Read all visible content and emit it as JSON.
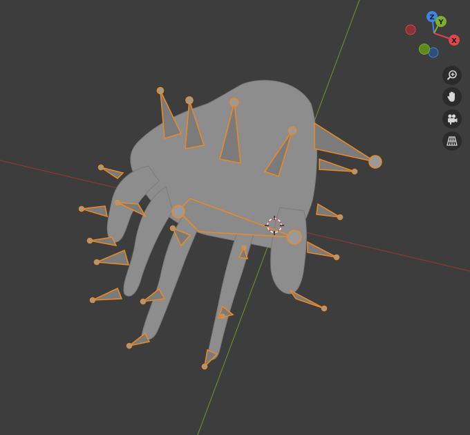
{
  "viewport": {
    "background": "#3d3d3d",
    "x_axis_color": "#8a3a3a",
    "y_axis_color": "#6a8a2a",
    "mesh_color": "#8d8d8d",
    "bone_outline": "#e98a26",
    "bone_fill": "#7b7b7b"
  },
  "gizmo": {
    "x_label": "X",
    "y_label": "Y",
    "z_label": "Z",
    "x_color": "#e0464c",
    "y_color": "#7fb02a",
    "z_color": "#3e84e0"
  },
  "nav_buttons": [
    {
      "icon": "zoom-icon"
    },
    {
      "icon": "hand-pan-icon"
    },
    {
      "icon": "camera-icon"
    },
    {
      "icon": "grid-perspective-icon"
    }
  ]
}
